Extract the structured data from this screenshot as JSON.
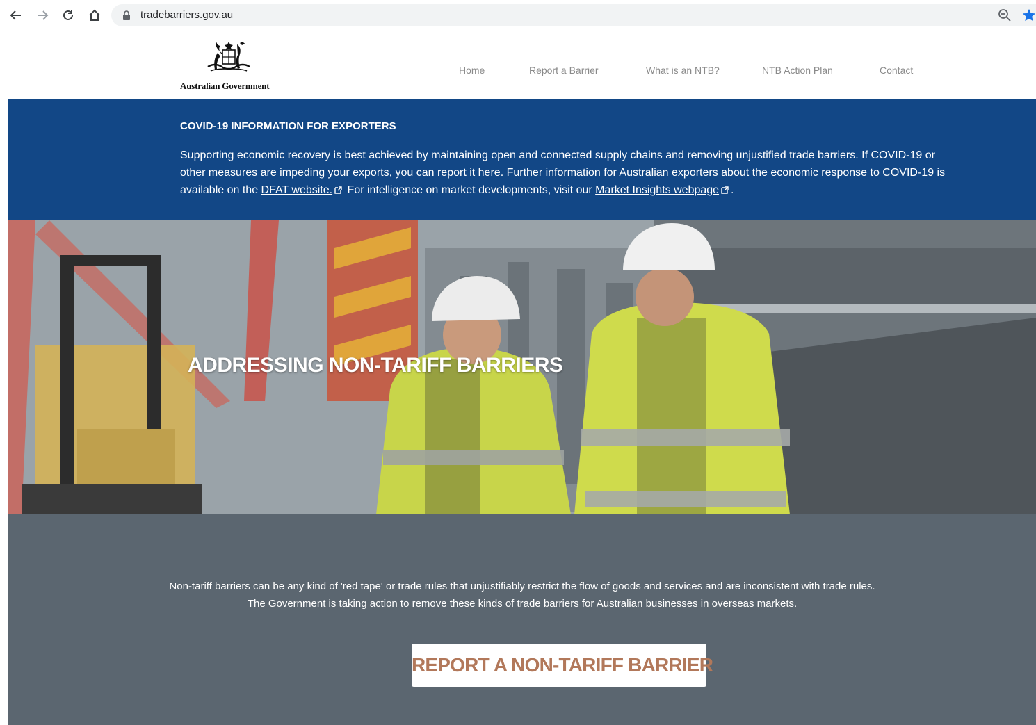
{
  "browser": {
    "url": "tradebarriers.gov.au",
    "icons": [
      "back-icon",
      "forward-icon",
      "reload-icon",
      "home-icon",
      "lock-icon",
      "zoom-icon",
      "star-icon"
    ],
    "star_color": "#1a73e8"
  },
  "header": {
    "logo_text": "Australian Government",
    "nav": [
      "Home",
      "Report a Barrier",
      "What is an NTB?",
      "NTB Action Plan",
      "Contact"
    ]
  },
  "covid": {
    "title": "COVID-19 INFORMATION FOR EXPORTERS",
    "text1": "Supporting economic recovery is best achieved by maintaining open and connected supply chains and removing unjustified trade barriers. If COVID-19 or other measures are impeding your exports, ",
    "link1": "you can report it here",
    "text2": ". Further information for Australian exporters about the economic response to COVID-19 is available on the ",
    "link2": "DFAT website.",
    "text3": " For intelligence on market developments, visit our ",
    "link3": "Market Insights webpage",
    "text4": ".",
    "background": "#124786"
  },
  "hero": {
    "title": "ADDRESSING NON-TARIFF BARRIERS"
  },
  "info": {
    "text": "Non-tariff barriers can be any kind of 'red tape' or trade rules that unjustifiably restrict the flow of goods and services and are inconsistent with trade rules. The Government is taking action to remove these kinds of trade barriers for Australian businesses in overseas markets.",
    "cta_label": "REPORT A NON-TARIFF BARRIER",
    "background": "#5b6670",
    "cta_color": "#b2785a"
  }
}
